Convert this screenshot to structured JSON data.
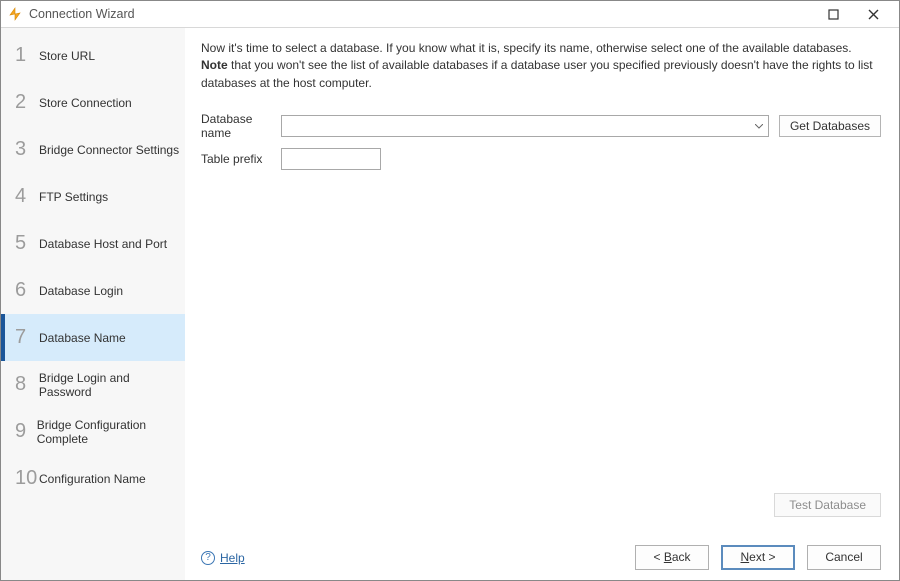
{
  "window": {
    "title": "Connection Wizard"
  },
  "sidebar": {
    "steps": [
      {
        "num": "1",
        "label": "Store URL"
      },
      {
        "num": "2",
        "label": "Store Connection"
      },
      {
        "num": "3",
        "label": "Bridge Connector Settings"
      },
      {
        "num": "4",
        "label": "FTP Settings"
      },
      {
        "num": "5",
        "label": "Database Host and Port"
      },
      {
        "num": "6",
        "label": "Database Login"
      },
      {
        "num": "7",
        "label": "Database Name"
      },
      {
        "num": "8",
        "label": "Bridge Login and Password"
      },
      {
        "num": "9",
        "label": "Bridge Configuration Complete"
      },
      {
        "num": "10",
        "label": "Configuration Name"
      }
    ],
    "active_index": 6
  },
  "intro": {
    "line1": "Now it's time to select a database. If you know what it is, specify its name, otherwise select one of the available databases.",
    "note_label": "Note",
    "note_rest": " that you won't see the list of available databases if a database user you specified previously doesn't have the rights to list databases at the host computer."
  },
  "form": {
    "dbname_label": "Database name",
    "dbname_value": "",
    "get_btn": "Get Databases",
    "prefix_label": "Table prefix",
    "prefix_value": ""
  },
  "buttons": {
    "test": "Test Database",
    "back_full": "< Back",
    "next_prefix": "N",
    "next_suffix": "ext >",
    "cancel": "Cancel"
  },
  "help": {
    "label": "Help"
  }
}
